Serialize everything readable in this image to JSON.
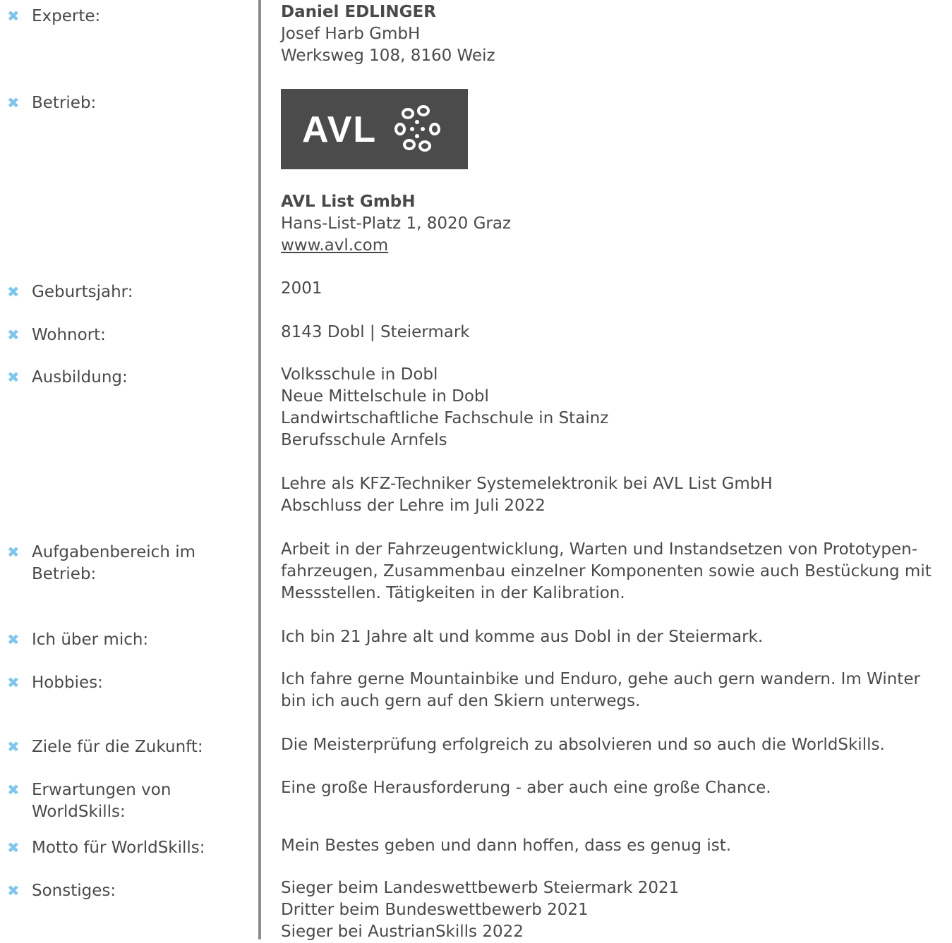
{
  "rows": [
    {
      "label": "Experte:",
      "lines": [
        "Daniel EDLINGER",
        "Josef Harb GmbH",
        "Werksweg 108, 8160 Weiz"
      ]
    },
    {
      "label": "Betrieb:",
      "logo_text": "AVL",
      "lines": [
        "AVL List GmbH",
        "Hans-List-Platz 1, 8020 Graz",
        "www.avl.com"
      ]
    },
    {
      "label": "Geburtsjahr:",
      "value": "2001"
    },
    {
      "label": "Wohnort:",
      "value": "8143 Dobl | Steiermark"
    },
    {
      "label": "Ausbildung:",
      "lines": [
        "Volksschule in Dobl",
        "Neue Mittelschule in Dobl",
        "Landwirtschaftliche Fachschule in Stainz",
        "Berufsschule Arnfels",
        "Lehre als KFZ-Techniker Systemelektronik bei AVL List GmbH",
        "Abschluss der Lehre im Juli 2022"
      ]
    },
    {
      "label_lines": [
        "Aufgabenbereich im",
        "Betrieb:"
      ],
      "lines": [
        "Arbeit in der Fahrzeugentwicklung, Warten und Instandsetzen von Prototypen-",
        "fahrzeugen, Zusammenbau einzelner Komponenten sowie auch Bestückung mit",
        "Messstellen. Tätigkeiten in der Kalibration."
      ]
    },
    {
      "label": "Ich über mich:",
      "value": "Ich bin 21 Jahre alt und komme aus Dobl in der Steiermark."
    },
    {
      "label": "Hobbies:",
      "lines": [
        "Ich fahre gerne Mountainbike und Enduro, gehe auch gern wandern. Im Winter",
        "bin ich auch gern auf den Skiern unterwegs."
      ]
    },
    {
      "label": "Ziele für die Zukunft:",
      "value": "Die Meisterprüfung erfolgreich zu absolvieren und so auch die WorldSkills."
    },
    {
      "label_lines": [
        "Erwartungen von",
        "WorldSkills:"
      ],
      "value": "Eine große Herausforderung - aber auch eine große Chance."
    },
    {
      "label": "Motto für WorldSkills:",
      "value": "Mein Bestes geben und dann hoffen, dass es genug ist."
    },
    {
      "label": "Sonstiges:",
      "lines": [
        "Sieger beim Landeswettbewerb Steiermark 2021",
        "Dritter beim Bundeswettbewerb 2021",
        "Sieger bei AustrianSkills 2022"
      ]
    }
  ],
  "colors": {
    "bullet": "#7fc7ea",
    "text": "#4a4a4a",
    "divider": "#8c8c8c",
    "logo_bg": "#4b4b4b"
  },
  "icons": {
    "bullet": "cross-bullet-icon"
  }
}
